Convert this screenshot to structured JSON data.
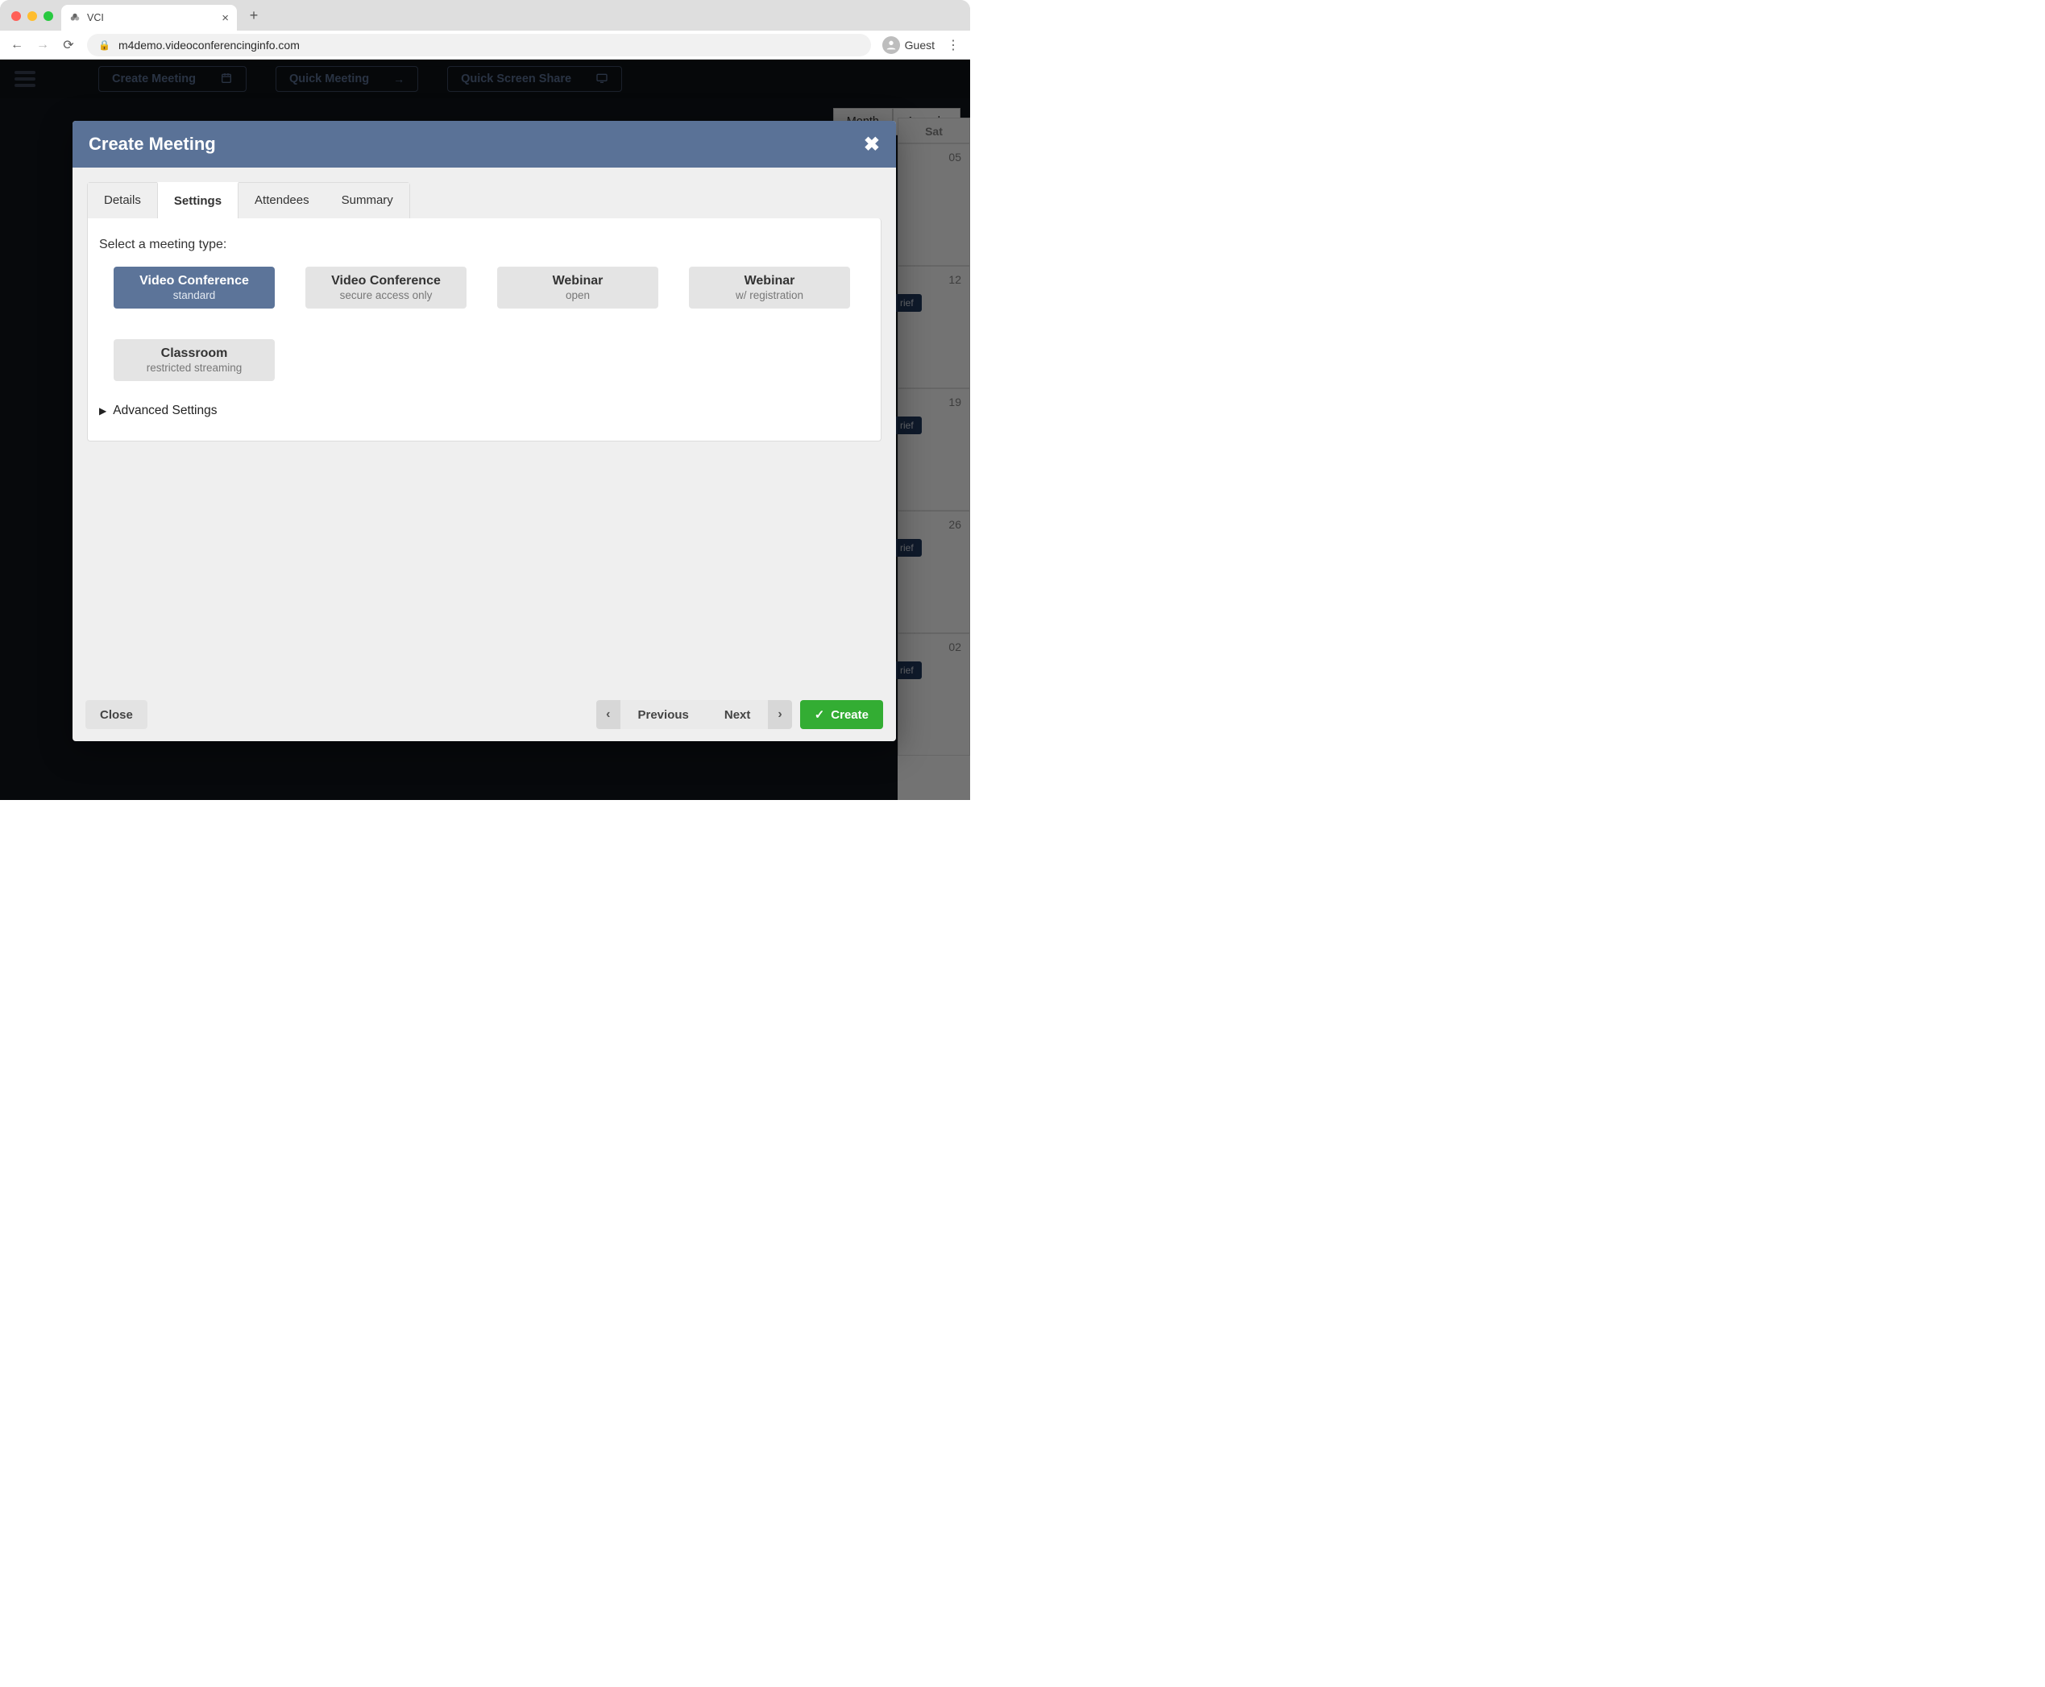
{
  "browser": {
    "tab_title": "VCI",
    "url": "m4demo.videoconferencinginfo.com",
    "guest_label": "Guest"
  },
  "topbar": {
    "create_meeting": "Create Meeting",
    "quick_meeting": "Quick Meeting",
    "quick_screen_share": "Quick Screen Share"
  },
  "calendar": {
    "view_month": "Month",
    "view_agenda": "Agenda",
    "sat_label": "Sat",
    "days": [
      "05",
      "12",
      "19",
      "26",
      "02"
    ],
    "event_label": "rief"
  },
  "modal": {
    "title": "Create Meeting",
    "tabs": {
      "details": "Details",
      "settings": "Settings",
      "attendees": "Attendees",
      "summary": "Summary"
    },
    "panel_label": "Select a meeting type:",
    "types": [
      {
        "title": "Video Conference",
        "sub": "standard",
        "selected": true
      },
      {
        "title": "Video Conference",
        "sub": "secure access only",
        "selected": false
      },
      {
        "title": "Webinar",
        "sub": "open",
        "selected": false
      },
      {
        "title": "Webinar",
        "sub": "w/ registration",
        "selected": false
      },
      {
        "title": "Classroom",
        "sub": "restricted streaming",
        "selected": false
      }
    ],
    "advanced_label": "Advanced Settings",
    "footer": {
      "close": "Close",
      "previous": "Previous",
      "next": "Next",
      "create": "Create"
    }
  }
}
